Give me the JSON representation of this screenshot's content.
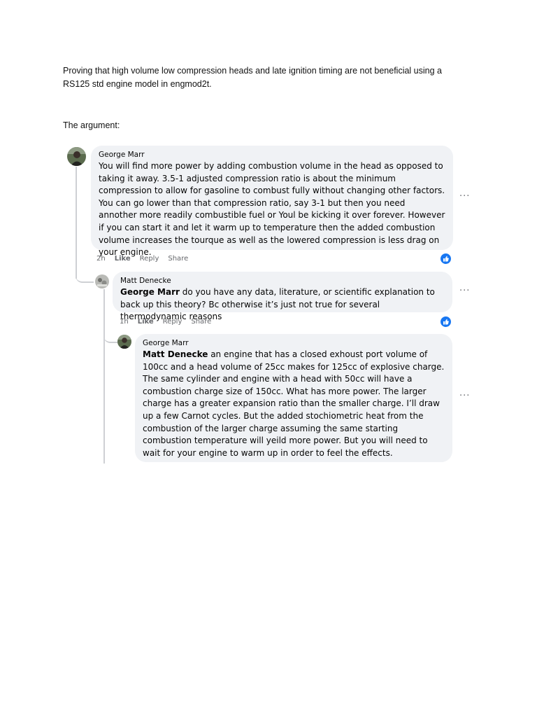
{
  "document": {
    "intro": "Proving that high volume low compression heads and late ignition timing are not beneficial using a RS125 std engine model in engmod2t.",
    "argument_label": "The argument:"
  },
  "comments": [
    {
      "author": "George Marr",
      "mention": "",
      "text": "You will find more power by adding combustion volume in the head as opposed to taking it away. 3.5-1 adjusted compression ratio is about the minimum compression to allow for gasoline to combust fully without changing other factors. You can go lower than that compression ratio, say 3-1 but then you need annother more readily combustible fuel or Youl be kicking it over forever. However if you can start it and let it warm up to temperature then the added combustion volume increases the tourque as well as the lowered compression is less drag on your engine.",
      "time": "2h",
      "actions": [
        "Like",
        "Reply",
        "Share"
      ],
      "more": "···"
    },
    {
      "author": "Matt Denecke",
      "mention": "George Marr",
      "text": " do you have any data, literature, or scientific explanation to back up this theory? Bc otherwise it’s just not true for several thermodynamic reasons",
      "time": "1h",
      "actions": [
        "Like",
        "Reply",
        "Share"
      ],
      "more": "···"
    },
    {
      "author": "George Marr",
      "mention": "Matt Denecke",
      "text": " an engine that has a closed exhoust port volume of 100cc and a head volume of 25cc makes for 125cc of explosive charge. The same cylinder and engine with a head with 50cc will have a combustion charge size of 150cc. What has more power. The larger charge has a greater expansion ratio than the smaller charge. I’ll draw up a few Carnot cycles. But the added stochiometric heat from the combustion of the larger charge assuming the same starting combustion temperature will yeild more power. But you will need to wait for your engine to warm up in order to feel the effects.",
      "more": "···"
    }
  ],
  "colors": {
    "bubble": "#f0f2f5",
    "meta": "#65676b",
    "like_blue": "#1877f2",
    "thread_line": "#ced0d4"
  },
  "icons": [
    "avatar-george",
    "avatar-matt",
    "like-reaction-icon",
    "more-options-icon"
  ]
}
